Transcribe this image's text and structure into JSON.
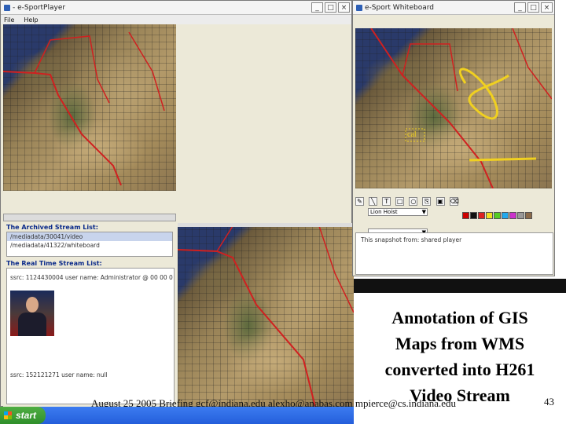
{
  "player_window": {
    "title": "- e-SportPlayer",
    "menu": [
      "File",
      "Help"
    ],
    "archived_heading": "The Archived Stream List:",
    "archived_items": [
      "/mediadata/30041/video",
      "/mediadata/41322/whiteboard"
    ],
    "realtime_heading": "The Real Time Stream List:",
    "realtime_items": [
      "ssrc: 1124430004   user name: Administrator @ 00 00 0",
      "ssrc: 152121271   user name: null"
    ]
  },
  "whiteboard_window": {
    "title": "e-Sport Whiteboard",
    "map_label": "cal",
    "font_select": "Lion Hoist",
    "size_select": "",
    "snapshot_text": "This snapshot from: shared player",
    "palette": [
      "#cc0000",
      "#111111",
      "#dd2222",
      "#f0e020",
      "#55cc22",
      "#22aaee",
      "#cc33cc",
      "#999999",
      "#8a6a4a"
    ]
  },
  "caption": {
    "lines": [
      "Annotation of GIS",
      "Maps from WMS",
      "converted into H261",
      "Video Stream"
    ]
  },
  "footer": {
    "text": "August 25 2005 Briefing   gcf@indiana.edu   alexho@anabas.com mpierce@cs.indiana.edu",
    "page_number": "43"
  },
  "taskbar": {
    "start_label": "start"
  },
  "colors": {
    "state_border": "#d02020",
    "annotation_yellow": "#f0d020",
    "titlebar": "#f4f4f4"
  }
}
